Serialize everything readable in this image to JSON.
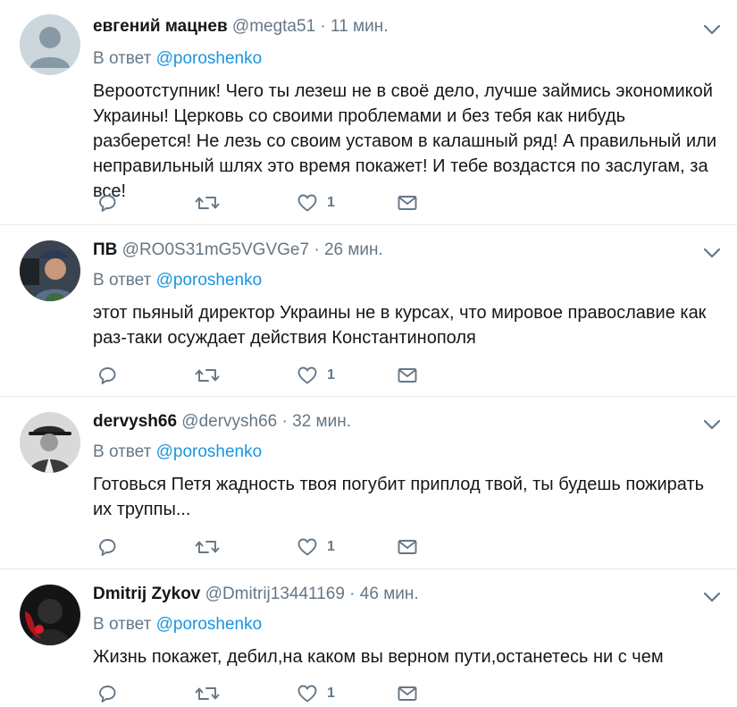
{
  "theme": {
    "text": "#14171a",
    "muted": "#657786",
    "link": "#1b95e0",
    "divider": "#e6ecf0"
  },
  "tweets": [
    {
      "name": "евгений мацнев",
      "handle": "@megta51",
      "separator": "·",
      "time": "11 мин.",
      "reply_prefix": "В ответ",
      "reply_to": "@poroshenko",
      "text": "Вероотступник! Чего ты лезеш не в своё дело, лучше займись экономикой Украины! Церковь со своими проблемами и без тебя как нибудь разберется! Не лезь со своим уставом в калашный ряд! А правильный или неправильный шлях это время покажет! И тебе воздастся по заслугам, за все!",
      "like_count": "1",
      "avatar": "default-profile-avatar"
    },
    {
      "name": "ПВ",
      "handle": "@RO0S31mG5VGVGe7",
      "separator": "·",
      "time": "26 мин.",
      "reply_prefix": "В ответ",
      "reply_to": "@poroshenko",
      "text": "этот пьяный директор Украины не в курсах, что мировое православие как раз-таки осуждает действия Константинополя",
      "like_count": "1",
      "avatar": "photo-avatar-man-in-cap"
    },
    {
      "name": "dervysh66",
      "handle": "@dervysh66",
      "separator": "·",
      "time": "32 мин.",
      "reply_prefix": "В ответ",
      "reply_to": "@poroshenko",
      "text": "Готовься Петя жадность твоя погубит приплод твой, ты будешь пожирать их труппы...",
      "like_count": "1",
      "avatar": "photo-avatar-man-in-hat"
    },
    {
      "name": "Dmitrij Zykov",
      "handle": "@Dmitrij13441169",
      "separator": "·",
      "time": "46 мин.",
      "reply_prefix": "В ответ",
      "reply_to": "@poroshenko",
      "text": "Жизнь покажет, дебил,на каком вы верном пути,останетесь ни с чем",
      "like_count": "1",
      "avatar": "photo-avatar-dark-red"
    }
  ],
  "icons": {
    "reply": "reply-icon",
    "retweet": "retweet-icon",
    "like": "heart-icon",
    "dm": "envelope-icon",
    "menu": "chevron-down-icon"
  }
}
